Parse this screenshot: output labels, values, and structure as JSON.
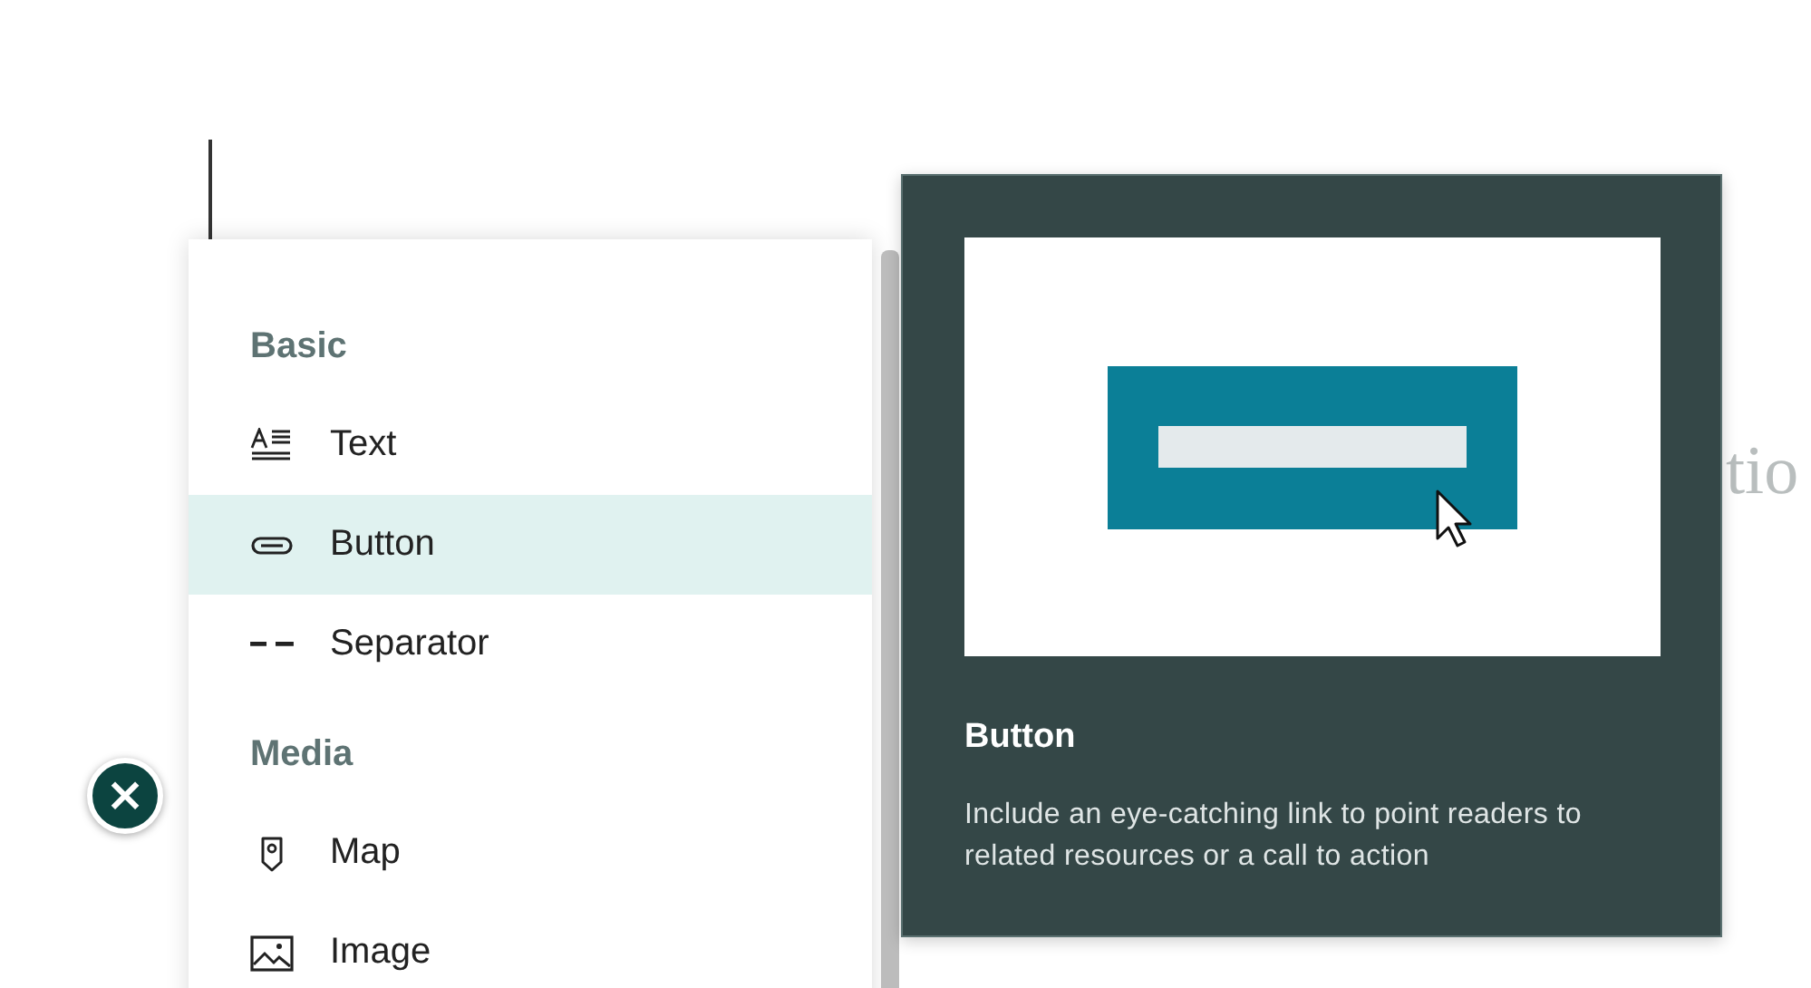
{
  "editor": {
    "subtitle_placeholder": "tio"
  },
  "block_menu": {
    "sections": [
      {
        "heading": "Basic",
        "items": [
          {
            "label": "Text",
            "kind": "text",
            "selected": false
          },
          {
            "label": "Button",
            "kind": "button",
            "selected": true
          },
          {
            "label": "Separator",
            "kind": "separator",
            "selected": false
          }
        ]
      },
      {
        "heading": "Media",
        "items": [
          {
            "label": "Map",
            "kind": "map",
            "selected": false
          },
          {
            "label": "Image",
            "kind": "image",
            "selected": false
          }
        ]
      }
    ]
  },
  "preview": {
    "title": "Button",
    "description": "Include an eye-catching link to point readers to related resources or a call to action"
  },
  "close_button": {
    "label": "×"
  }
}
